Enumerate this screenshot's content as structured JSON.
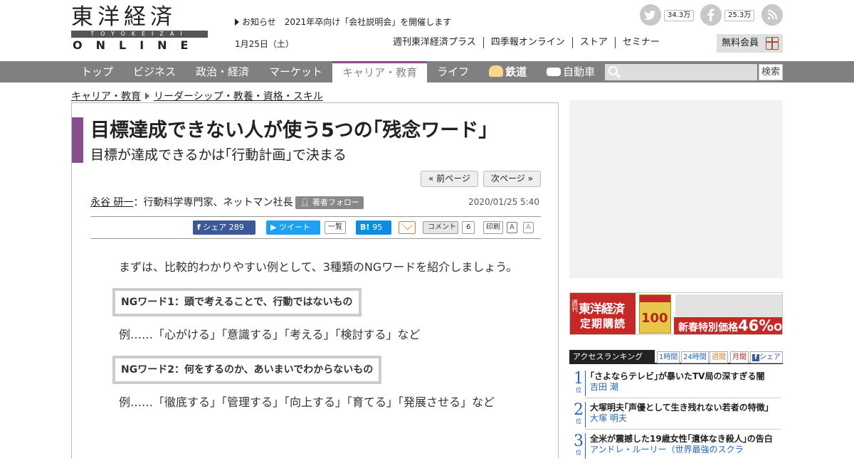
{
  "header": {
    "logo_kanji": "東洋経済",
    "logo_roman": "TOYOKEIZAI",
    "logo_online": "ONLINE",
    "notice_label": "お知らせ",
    "notice_text": "2021年卒向け「会社説明会」を開催します",
    "date": "1月25日（土）",
    "subnav": [
      "週刊東洋経済プラス",
      "四季報オンライン",
      "ストア",
      "セミナー"
    ],
    "member_label": "無料会員",
    "social": {
      "twitter_count": "34.3万",
      "facebook_count": "25.3万"
    }
  },
  "nav": {
    "items": [
      "トップ",
      "ビジネス",
      "政治・経済",
      "マーケット",
      "キャリア・教育",
      "ライフ",
      "鉄道",
      "自動車"
    ],
    "active_index": 4,
    "search_placeholder": "",
    "search_button": "検索"
  },
  "breadcrumb": [
    "キャリア・教育",
    "リーダーシップ・教養・資格・スキル"
  ],
  "article": {
    "title": "目標達成できない人が使う5つの｢残念ワード｣",
    "subtitle": "目標が達成できるかは｢行動計画｣で決まる",
    "prev_page": "« 前ページ",
    "next_page": "次ページ »",
    "author_name": "永谷 研一",
    "author_title": "：行動科学専門家、ネットマン社長",
    "follow_label": "著者フォロー",
    "published": "2020/01/25 5:40",
    "share": {
      "facebook": "シェア",
      "facebook_count": "289",
      "tweet": "ツイート",
      "list": "一覧",
      "hatena": "B!",
      "hatena_count": "95",
      "comment": "コメント",
      "comment_count": "6",
      "print": "印刷",
      "font_large": "A",
      "font_small": "A"
    },
    "body": {
      "intro": "まずは、比較的わかりやすい例として、3種類のNGワードを紹介しましょう。",
      "ng1_title": "NGワード1：頭で考えることで、行動ではないもの",
      "ng1_example": "例……「心がける」「意識する」「考える」「検討する」など",
      "ng2_title": "NGワード2：何をするのか、あいまいでわからないもの",
      "ng2_example": "例……「徹底する」「管理する」「向上する」「育てる」「発展させる」など"
    }
  },
  "sidebar": {
    "banner": {
      "small": "週刊",
      "brand": "東洋経済",
      "subscribe": "定期購読",
      "magazine_number": "100",
      "price_text": "新春特別価格",
      "discount": "46%",
      "off": "OFF"
    },
    "ranking": {
      "title": "アクセスランキング",
      "tabs": [
        "1時間",
        "24時間",
        "週間",
        "月間",
        "シェア"
      ],
      "items": [
        {
          "rank": "1",
          "suffix": "位",
          "title": "｢さよならテレビ｣が暴いたTV局の深すぎる闇",
          "author": "吉田 潮"
        },
        {
          "rank": "2",
          "suffix": "位",
          "title": "大塚明夫｢声優として生き残れない若者の特徴｣",
          "author": "大塚 明夫"
        },
        {
          "rank": "3",
          "suffix": "位",
          "title": "全米が震撼した19歳女性｢遺体なき殺人｣の告白",
          "author": "アンドレ・ルーリー（世界最強のスクラ"
        }
      ]
    }
  },
  "colors": {
    "accent_purple": "#8a4d8e",
    "nav_gray": "#808080",
    "facebook": "#3b5998",
    "twitter": "#1da1f2",
    "hatena": "#0a8ee0",
    "banner_red": "#c62828",
    "link_blue": "#2266bb"
  }
}
